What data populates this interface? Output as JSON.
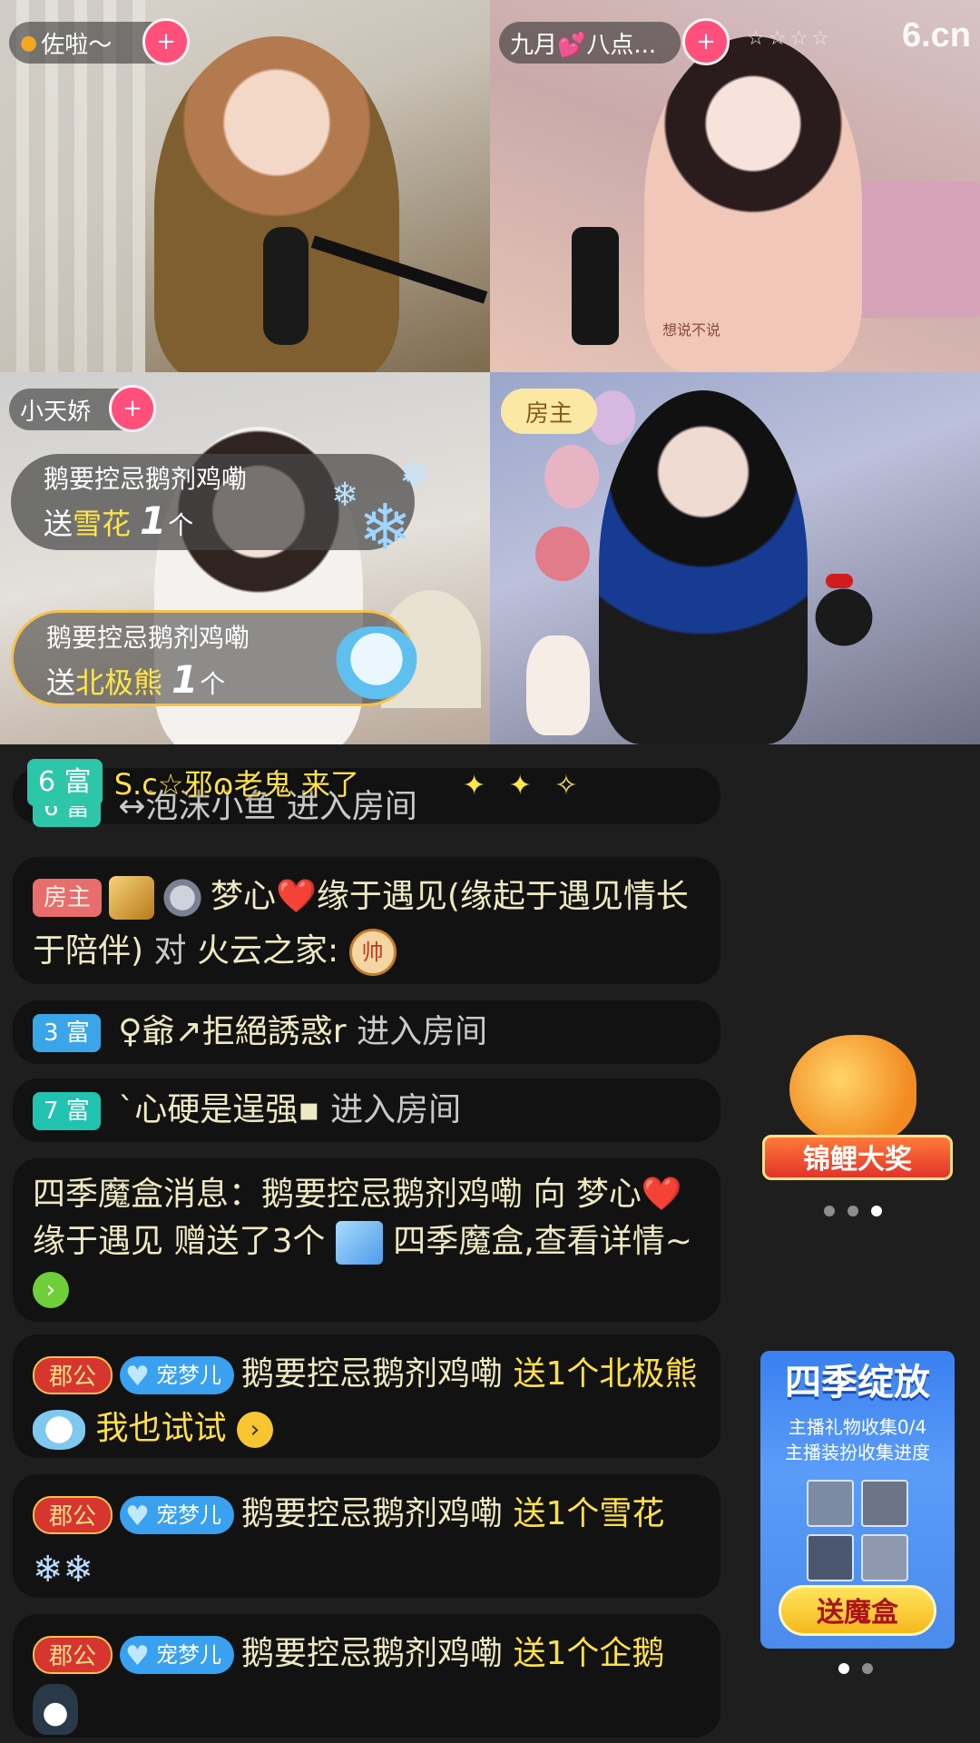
{
  "video_tiles": [
    {
      "name": "佐啦～",
      "follow": "+"
    },
    {
      "name": "九月💕八点...",
      "follow": "+",
      "stars": "☆☆☆☆",
      "caption": "想说不说"
    },
    {
      "name": "小天娇",
      "follow": "+"
    },
    {
      "role": "房主"
    }
  ],
  "logo": "6.cn",
  "gift_banners": [
    {
      "sender": "鹅要控忌鹅剂鸡嘞",
      "send": "送",
      "gift": "雪花",
      "count": "1",
      "unit": "个"
    },
    {
      "sender": "鹅要控忌鹅剂鸡嘞",
      "send": "送",
      "gift": "北极熊",
      "count": "1",
      "unit": "个"
    }
  ],
  "enter_banner": {
    "level": "6 富",
    "text": "S.c☆邪ɷ老鬼 来了",
    "sparkle": "✦ ✦ ✧"
  },
  "chat": [
    {
      "badge": "6 富",
      "user": "↔泡沫小鱼",
      "action": "进入房间"
    },
    {
      "badge": "房主",
      "user": "梦心❤️缘于遇见(缘起于遇见情长于陪伴)",
      "mid": "对",
      "target": "火云之家:",
      "icon": "帅"
    },
    {
      "badge": "3 富",
      "user": "♀爺↗拒絕誘惑r",
      "action": "进入房间"
    },
    {
      "badge": "7 富",
      "user": "`心硬是逞强▪",
      "action": "进入房间"
    },
    {
      "text": "四季魔盒消息：鹅要控忌鹅剂鸡嘞 向 梦心❤️缘于遇见 赠送了3个",
      "gift": "四季魔盒,查看详情~",
      "arrow": "›"
    },
    {
      "duke": "郡公",
      "pet": "宠梦儿",
      "user": "鹅要控忌鹅剂鸡嘞",
      "gift": "送1个北极熊",
      "extra": "我也试试",
      "arrow": "›"
    },
    {
      "duke": "郡公",
      "pet": "宠梦儿",
      "user": "鹅要控忌鹅剂鸡嘞",
      "gift": "送1个雪花"
    },
    {
      "duke": "郡公",
      "pet": "宠梦儿",
      "user": "鹅要控忌鹅剂鸡嘞",
      "gift": "送1个企鹅"
    }
  ],
  "koi": {
    "label": "锦鲤大奖"
  },
  "season_card": {
    "title": "四季绽放",
    "line1": "主播礼物收集0/4",
    "line2": "主播装扮收集进度",
    "button": "送魔盒"
  },
  "colors": {
    "accent_pink": "#ff4f7b",
    "gold_text": "#ffe04a",
    "chat_bg": "#121212"
  }
}
